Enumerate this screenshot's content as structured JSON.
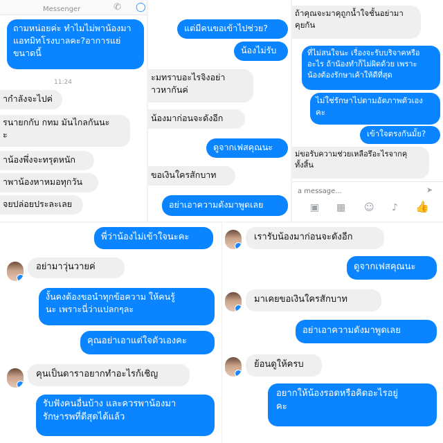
{
  "top_left": {
    "header_title": "Messenger",
    "timestamp": "11:24",
    "msg_out_1": "ถามหน่อยค่ะ ทำไมไม่พาน้องมา",
    "msg_out_2": "แอทมิทโรงบาลคะ?อาการแย่",
    "msg_out_3": "ขนาดนี้",
    "msg_in_1": "ากำลังจะไปค่",
    "msg_in_2a": "รนายกกับ กทม มันไกลกันนะ",
    "msg_in_2b": "ะ",
    "msg_in_3": "าน้องพึ่งจะทรุดหนัก",
    "msg_in_4": "าพาน้องหาหมอทุกวัน",
    "msg_in_5": "จยปล่อยประละเลย"
  },
  "top_middle": {
    "msg_out_1": "แต่มีคนขอเข้าไปช่วย?",
    "msg_out_2": "น้องไม่รับ",
    "msg_in_1a": "ะมทราบอะไรจิงอย่า",
    "msg_in_1b": "าวหากันค่",
    "msg_in_2": "น้องมาก่อนจะดังอีก",
    "msg_out_3": "ดูจากเฟสคุณนะ",
    "msg_in_3": "ขอเงินใครสักบาท",
    "msg_out_4": "อย่าเอาความดังมาพูดเลย"
  },
  "top_right": {
    "msg_in_1a": "ถ้าคุณจะมาคุถูกน้ำใจชั้นอย่ามา",
    "msg_in_1b": "คุยกัน",
    "msg_out_1a": "ที่ไม่สนใจนะ เรื่องจะรับบริจาคหรือ",
    "msg_out_1b": "อะไร ถ้าน้องทำก็ไม่ผิดด้วย เพราะ",
    "msg_out_1c": "น้องต้องรักษาเค้าให้ดีที่สุด",
    "msg_out_2a": "ไม่ใช่รักษาไปตามอัตภาพตัวเอง",
    "msg_out_2b": "คะ",
    "msg_out_3": "เข้าใจตรงกันมั้ย?",
    "msg_in_2a": "ม่ขอรับความช่วยเหลือรึอะไรจากคุ",
    "msg_in_2b": "ทั้งสิ้น",
    "compose_placeholder": "a message..."
  },
  "bottom_left": {
    "msg_out_1": "พี่ว่าน้องไม่เข้าใจนะคะ",
    "msg_in_1": "อย่ามาวุ่นวายค่",
    "msg_out_2a": "งั้นคงต้องขอนำทุกข้อความ ให้คนรู้",
    "msg_out_2b": "นะ เพราะนี่ว่าแปลกๆละ",
    "msg_out_3": "คุณอย่าเอาแต่ใจตัวเองคะ",
    "msg_in_2": "คุนเป็นดาราอยากทำอะไรก้เชิญ",
    "msg_out_4a": "รับฟังคนอื่นบ้าง และควรพาน้องมา",
    "msg_out_4b": "รักษารพที่ดีสุดได้แล้ว"
  },
  "bottom_right": {
    "msg_in_1": "เรารับน้องมาก่อนจะดังอีก",
    "msg_out_1": "ดูจากเฟสคุณนะ",
    "msg_in_2": "มาเคยขอเงินใครสักบาท",
    "msg_out_2": "อย่าเอาความดังมาพูดเลย",
    "msg_in_3": "ย้อนดูให้ครบ",
    "msg_out_3a": "อยากให้น้องรอดหรือคิดอะไรอยู่",
    "msg_out_3b": "คะ"
  },
  "colors": {
    "outgoing_bubble": "#0a84ff",
    "incoming_bubble": "#efefef",
    "messenger_badge": "#1e88ff"
  },
  "icons": [
    "phone-icon",
    "camera-icon",
    "image-icon",
    "emoji-icon",
    "mic-icon",
    "like-icon",
    "send-icon"
  ]
}
